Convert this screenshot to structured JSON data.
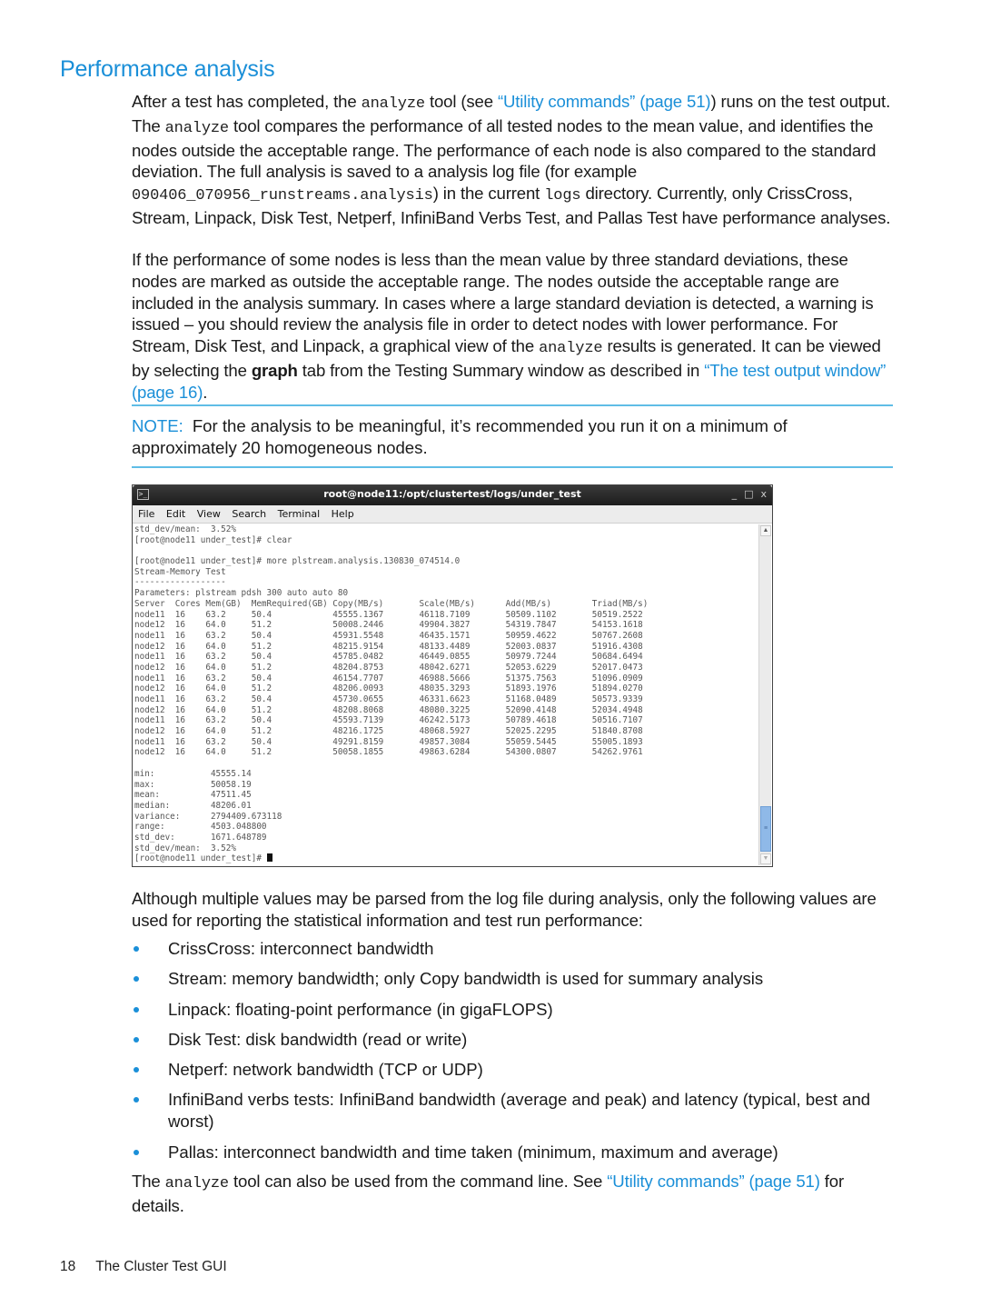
{
  "section_title": "Performance analysis",
  "paragraph1": {
    "t1": "After a test has completed, the ",
    "code1": "analyze",
    "t2": " tool (see ",
    "link1": "“Utility commands” (page 51)",
    "t3": ") runs on the test output. The ",
    "code2": "analyze",
    "t4": " tool compares the performance of all tested nodes to the mean value, and identifies the nodes outside the acceptable range. The performance of each node is also compared to the standard deviation. The full analysis is saved to a analysis log file (for example ",
    "code3": "090406_070956_runstreams.analysis",
    "t5": ") in the current ",
    "code4": "logs",
    "t6": " directory. Currently, only CrissCross, Stream, Linpack, Disk Test, Netperf, InfiniBand Verbs Test, and Pallas Test have performance analyses."
  },
  "paragraph2": {
    "t1": "If the performance of some nodes is less than the mean value by three standard deviations, these nodes are marked as outside the acceptable range. The nodes outside the acceptable range are included in the analysis summary. In cases where a large standard deviation is detected, a warning is issued – you should review the analysis file in order to detect nodes with lower performance. For Stream, Disk Test, and Linpack, a graphical view of the ",
    "code1": "analyze",
    "t2": " results is generated. It can be viewed by selecting the ",
    "bold1": "graph",
    "t3": " tab from the Testing Summary window as described in ",
    "link1": "“The test output window” (page 16)",
    "t4": "."
  },
  "note": {
    "label": "NOTE:",
    "text": "For the analysis to be meaningful, it’s recommended you run it on a minimum of approximately 20 homogeneous nodes."
  },
  "terminal": {
    "title": "root@node11:/opt/clustertest/logs/under_test",
    "window_buttons": [
      "_",
      "□",
      "x"
    ],
    "menu": [
      "File",
      "Edit",
      "View",
      "Search",
      "Terminal",
      "Help"
    ],
    "pre_lines": [
      "std_dev/mean:  3.52%",
      "[root@node11 under_test]# clear",
      "",
      "[root@node11 under_test]# more plstream.analysis.130830_074514.0",
      "Stream-Memory Test",
      "------------------",
      "Parameters: plstream pdsh 300 auto auto 80"
    ],
    "table_headers": [
      "Server",
      "Cores",
      "Mem(GB)",
      "MemRequired(GB)",
      "Copy(MB/s)",
      "Scale(MB/s)",
      "Add(MB/s)",
      "Triad(MB/s)"
    ],
    "table_rows": [
      [
        "node11",
        "16",
        "63.2",
        "50.4",
        "45555.1367",
        "46118.7109",
        "50509.1102",
        "50519.2522"
      ],
      [
        "node12",
        "16",
        "64.0",
        "51.2",
        "50008.2446",
        "49904.3827",
        "54319.7847",
        "54153.1618"
      ],
      [
        "node11",
        "16",
        "63.2",
        "50.4",
        "45931.5548",
        "46435.1571",
        "50959.4622",
        "50767.2608"
      ],
      [
        "node12",
        "16",
        "64.0",
        "51.2",
        "48215.9154",
        "48133.4489",
        "52003.0837",
        "51916.4308"
      ],
      [
        "node11",
        "16",
        "63.2",
        "50.4",
        "45785.0482",
        "46449.0855",
        "50979.7244",
        "50684.6494"
      ],
      [
        "node12",
        "16",
        "64.0",
        "51.2",
        "48204.8753",
        "48042.6271",
        "52053.6229",
        "52017.0473"
      ],
      [
        "node11",
        "16",
        "63.2",
        "50.4",
        "46154.7707",
        "46988.5666",
        "51375.7563",
        "51096.0909"
      ],
      [
        "node12",
        "16",
        "64.0",
        "51.2",
        "48206.0093",
        "48035.3293",
        "51893.1976",
        "51894.0270"
      ],
      [
        "node11",
        "16",
        "63.2",
        "50.4",
        "45730.0655",
        "46331.6623",
        "51168.0489",
        "50573.9339"
      ],
      [
        "node12",
        "16",
        "64.0",
        "51.2",
        "48208.8068",
        "48080.3225",
        "52090.4148",
        "52034.4948"
      ],
      [
        "node11",
        "16",
        "63.2",
        "50.4",
        "45593.7139",
        "46242.5173",
        "50789.4618",
        "50516.7107"
      ],
      [
        "node12",
        "16",
        "64.0",
        "51.2",
        "48216.1725",
        "48068.5927",
        "52025.2295",
        "51840.8708"
      ],
      [
        "node11",
        "16",
        "63.2",
        "50.4",
        "49291.8159",
        "49857.3084",
        "55059.5445",
        "55005.1893"
      ],
      [
        "node12",
        "16",
        "64.0",
        "51.2",
        "50058.1855",
        "49863.6284",
        "54300.0807",
        "54262.9761"
      ]
    ],
    "stats": [
      [
        "min:",
        "45555.14"
      ],
      [
        "max:",
        "50058.19"
      ],
      [
        "mean:",
        "47511.45"
      ],
      [
        "median:",
        "48206.01"
      ],
      [
        "variance:",
        "2794409.673118"
      ],
      [
        "range:",
        "4503.048800"
      ],
      [
        "std_dev:",
        "1671.648789"
      ],
      [
        "std_dev/mean:",
        "3.52%"
      ]
    ],
    "prompt": "[root@node11 under_test]# "
  },
  "paragraph3": "Although multiple values may be parsed from the log file during analysis, only the following values are used for reporting the statistical information and test run performance:",
  "bullets": [
    "CrissCross: interconnect bandwidth",
    "Stream: memory bandwidth; only Copy bandwidth is used for summary analysis",
    "Linpack: floating-point performance (in gigaFLOPS)",
    "Disk Test: disk bandwidth (read or write)",
    "Netperf: network bandwidth (TCP or UDP)",
    "InfiniBand verbs tests: InfiniBand bandwidth (average and peak) and latency (typical, best and worst)",
    "Pallas: interconnect bandwidth and time taken (minimum, maximum and average)"
  ],
  "paragraph4": {
    "t1": "The ",
    "code1": "analyze",
    "t2": " tool can also be used from the command line. See ",
    "link1": "“Utility commands” (page 51)",
    "t3": " for details."
  },
  "footer": {
    "page_number": "18",
    "chapter": "The Cluster Test GUI"
  }
}
